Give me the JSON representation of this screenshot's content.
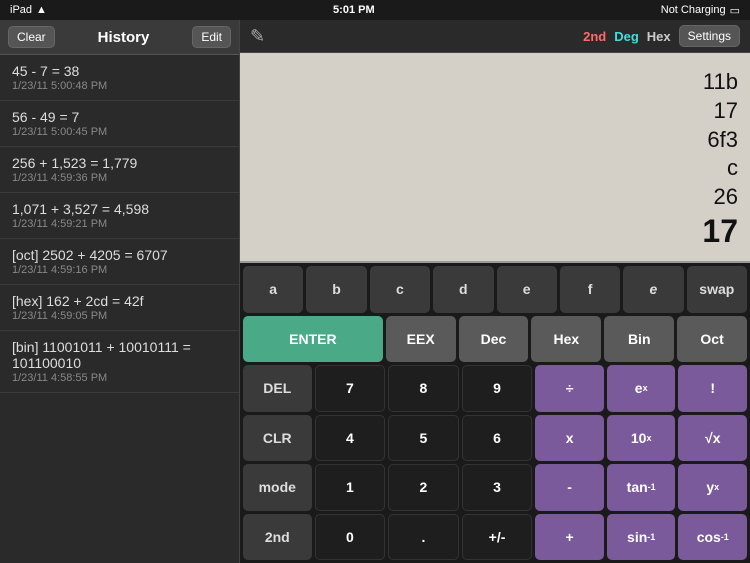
{
  "status": {
    "left": "iPad",
    "time": "5:01 PM",
    "right": "Not Charging"
  },
  "history": {
    "clear_label": "Clear",
    "title": "History",
    "edit_label": "Edit",
    "items": [
      {
        "expr": "45 - 7 = 38",
        "date": "1/23/11 5:00:48 PM"
      },
      {
        "expr": "56 - 49 = 7",
        "date": "1/23/11 5:00:45 PM"
      },
      {
        "expr": "256 + 1,523 = 1,779",
        "date": "1/23/11 4:59:36 PM"
      },
      {
        "expr": "1,071 + 3,527 = 4,598",
        "date": "1/23/11 4:59:21 PM"
      },
      {
        "expr": "[oct] 2502 + 4205 = 6707",
        "date": "1/23/11 4:59:16 PM"
      },
      {
        "expr": "[hex] 162 + 2cd = 42f",
        "date": "1/23/11 4:59:05 PM"
      },
      {
        "expr": "[bin] 11001011 + 10010111 = 101100010",
        "date": "1/23/11 4:58:55 PM"
      }
    ]
  },
  "display": {
    "lines": [
      "11b",
      "17",
      "6f3",
      "c",
      "26",
      "17"
    ]
  },
  "modes": {
    "second": "2nd",
    "deg": "Deg",
    "hex": "Hex"
  },
  "settings_label": "Settings",
  "keypad": {
    "rows": [
      [
        {
          "label": "a",
          "type": "dark"
        },
        {
          "label": "b",
          "type": "dark"
        },
        {
          "label": "c",
          "type": "dark"
        },
        {
          "label": "d",
          "type": "dark"
        },
        {
          "label": "e",
          "type": "dark"
        },
        {
          "label": "f",
          "type": "dark"
        },
        {
          "label": "e",
          "type": "dark",
          "italic": true
        },
        {
          "label": "swap",
          "type": "dark"
        }
      ],
      [
        {
          "label": "ENTER",
          "type": "green",
          "span": 2
        },
        {
          "label": "EEX",
          "type": "gray"
        },
        {
          "label": "Dec",
          "type": "gray"
        },
        {
          "label": "Hex",
          "type": "gray"
        },
        {
          "label": "Bin",
          "type": "gray"
        },
        {
          "label": "Oct",
          "type": "gray"
        }
      ],
      [
        {
          "label": "DEL",
          "type": "dark"
        },
        {
          "label": "7",
          "type": "black"
        },
        {
          "label": "8",
          "type": "black"
        },
        {
          "label": "9",
          "type": "black"
        },
        {
          "label": "÷",
          "type": "purple"
        },
        {
          "label": "eˣ",
          "type": "purple"
        },
        {
          "label": "!",
          "type": "purple"
        }
      ],
      [
        {
          "label": "CLR",
          "type": "dark"
        },
        {
          "label": "4",
          "type": "black"
        },
        {
          "label": "5",
          "type": "black"
        },
        {
          "label": "6",
          "type": "black"
        },
        {
          "label": "×",
          "type": "purple"
        },
        {
          "label": "10ˣ",
          "type": "purple"
        },
        {
          "label": "√x",
          "type": "purple"
        }
      ],
      [
        {
          "label": "mode",
          "type": "dark"
        },
        {
          "label": "1",
          "type": "black"
        },
        {
          "label": "2",
          "type": "black"
        },
        {
          "label": "3",
          "type": "black"
        },
        {
          "label": "-",
          "type": "purple"
        },
        {
          "label": "tan⁻¹",
          "type": "purple"
        },
        {
          "label": "yˣ",
          "type": "purple"
        }
      ],
      [
        {
          "label": "2nd",
          "type": "dark"
        },
        {
          "label": "0",
          "type": "black"
        },
        {
          "label": ".",
          "type": "black"
        },
        {
          "label": "+/-",
          "type": "black"
        },
        {
          "label": "+",
          "type": "purple"
        },
        {
          "label": "sin⁻¹",
          "type": "purple"
        },
        {
          "label": "cos⁻¹",
          "type": "purple"
        }
      ]
    ]
  }
}
